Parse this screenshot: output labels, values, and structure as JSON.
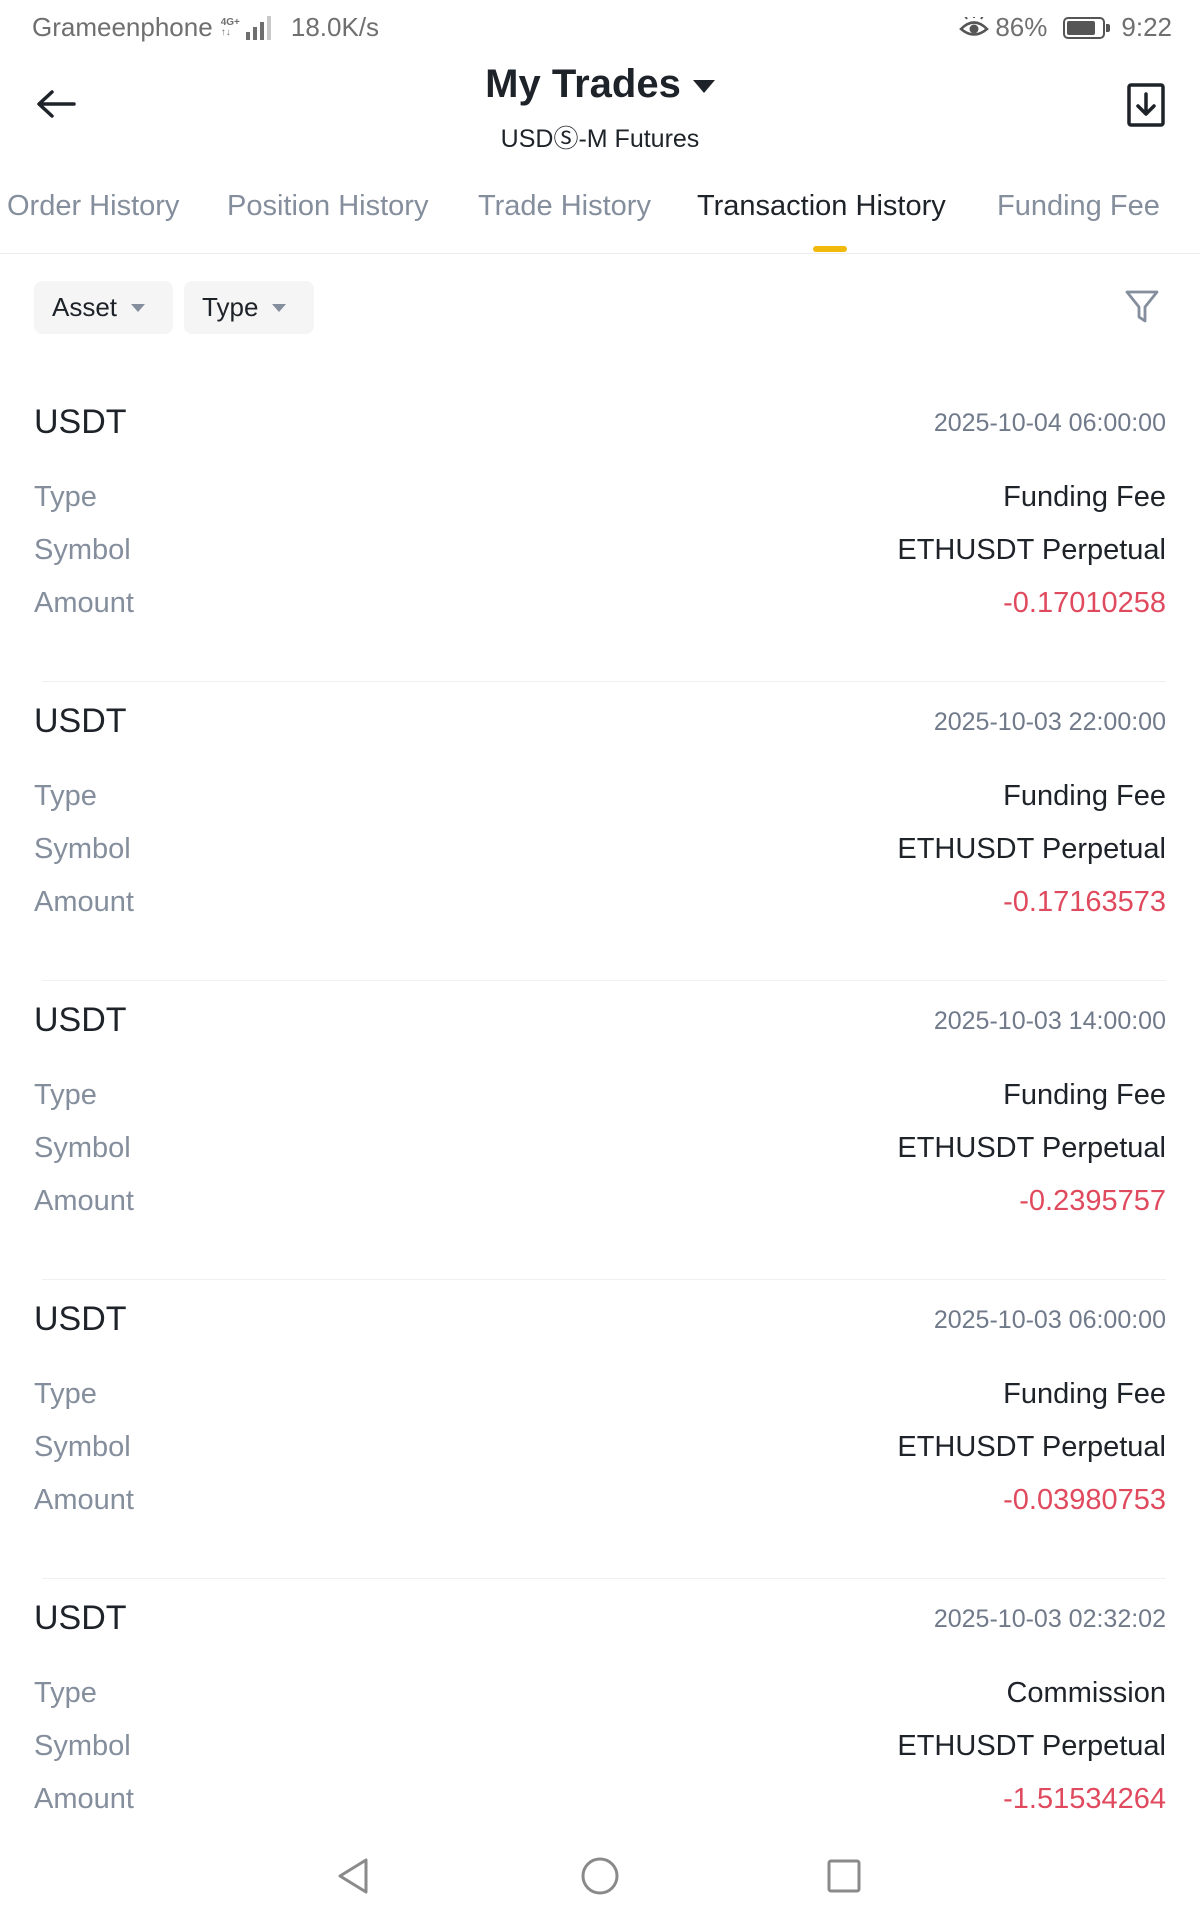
{
  "status_bar": {
    "carrier": "Grameenphone",
    "network_type": "4G+",
    "speed": "18.0K/s",
    "battery": "86%",
    "battery_level": 0.86,
    "time": "9:22"
  },
  "header": {
    "title": "My Trades",
    "subtitle": "USDⓈ-M Futures"
  },
  "tabs": [
    {
      "label": "Order History",
      "active": false
    },
    {
      "label": "Position History",
      "active": false
    },
    {
      "label": "Trade History",
      "active": false
    },
    {
      "label": "Transaction History",
      "active": true
    },
    {
      "label": "Funding Fee",
      "active": false
    }
  ],
  "filters": {
    "asset_label": "Asset",
    "type_label": "Type"
  },
  "labels": {
    "type": "Type",
    "symbol": "Symbol",
    "amount": "Amount"
  },
  "records": [
    {
      "asset": "USDT",
      "time": "2025-10-04 06:00:00",
      "type": "Funding Fee",
      "symbol": "ETHUSDT Perpetual",
      "amount": "-0.17010258"
    },
    {
      "asset": "USDT",
      "time": "2025-10-03 22:00:00",
      "type": "Funding Fee",
      "symbol": "ETHUSDT Perpetual",
      "amount": "-0.17163573"
    },
    {
      "asset": "USDT",
      "time": "2025-10-03 14:00:00",
      "type": "Funding Fee",
      "symbol": "ETHUSDT Perpetual",
      "amount": "-0.2395757"
    },
    {
      "asset": "USDT",
      "time": "2025-10-03 06:00:00",
      "type": "Funding Fee",
      "symbol": "ETHUSDT Perpetual",
      "amount": "-0.03980753"
    },
    {
      "asset": "USDT",
      "time": "2025-10-03 02:32:02",
      "type": "Commission",
      "symbol": "ETHUSDT Perpetual",
      "amount": "-1.51534264"
    }
  ],
  "colors": {
    "accent": "#f0b90b",
    "negative": "#e04a5e",
    "muted": "#848e9c",
    "text": "#1e2329"
  }
}
